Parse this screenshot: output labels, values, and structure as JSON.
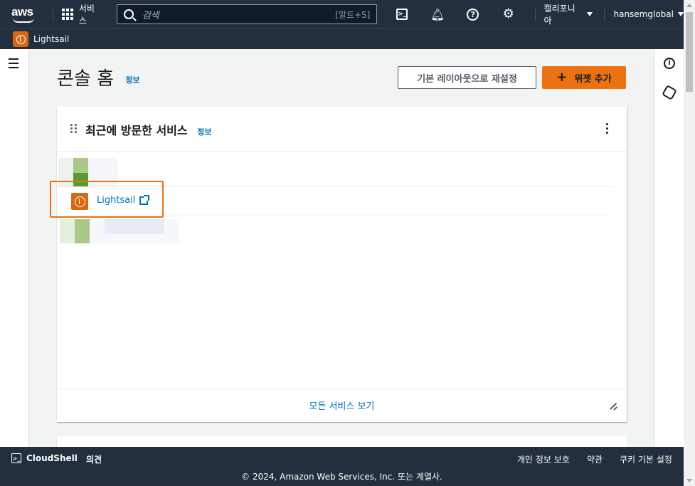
{
  "topbar": {
    "logo": "aws",
    "services_label": "서비스",
    "search_placeholder": "검색",
    "search_shortcut": "[알트+S]",
    "region_label": "캘리포니아",
    "account_label": "hansemglobal"
  },
  "favorites": {
    "items": [
      {
        "label": "Lightsail",
        "icon": "lightsail-icon"
      }
    ]
  },
  "page": {
    "title": "콘솔 홈",
    "info_label": "정보",
    "reset_layout_label": "기본 레이아웃으로 재설정",
    "add_widget_label": "위젯 추가"
  },
  "recent_widget": {
    "title": "최근에 방문한 서비스",
    "info_label": "정보",
    "items": [
      {
        "label": "Lightsail",
        "icon": "lightsail-icon",
        "external": true
      }
    ],
    "footer_link": "모든 서비스 보기"
  },
  "footer": {
    "cloudshell_label": "CloudShell",
    "feedback_label": "의견",
    "privacy_label": "개인 정보 보호",
    "terms_label": "약관",
    "cookies_label": "쿠키 기본 설정",
    "copyright": "© 2024, Amazon Web Services, Inc. 또는 계열사."
  },
  "colors": {
    "nav_bg": "#232f3e",
    "accent_orange": "#ec7211",
    "link_blue": "#0073bb",
    "lightsail_orange": "#d86613"
  }
}
